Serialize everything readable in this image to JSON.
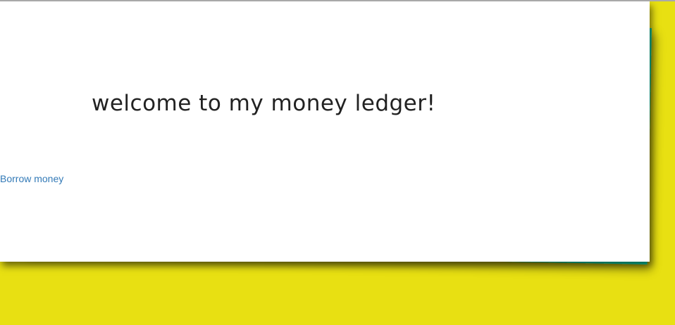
{
  "page": {
    "title": "welcome to my money ledger!",
    "borrow_link_label": "Borrow money"
  },
  "colors": {
    "background": "#e8e012",
    "back_sheet": "#12c9a0",
    "front_sheet": "#ffffff",
    "link": "#337ab7",
    "title_text": "#222222"
  }
}
